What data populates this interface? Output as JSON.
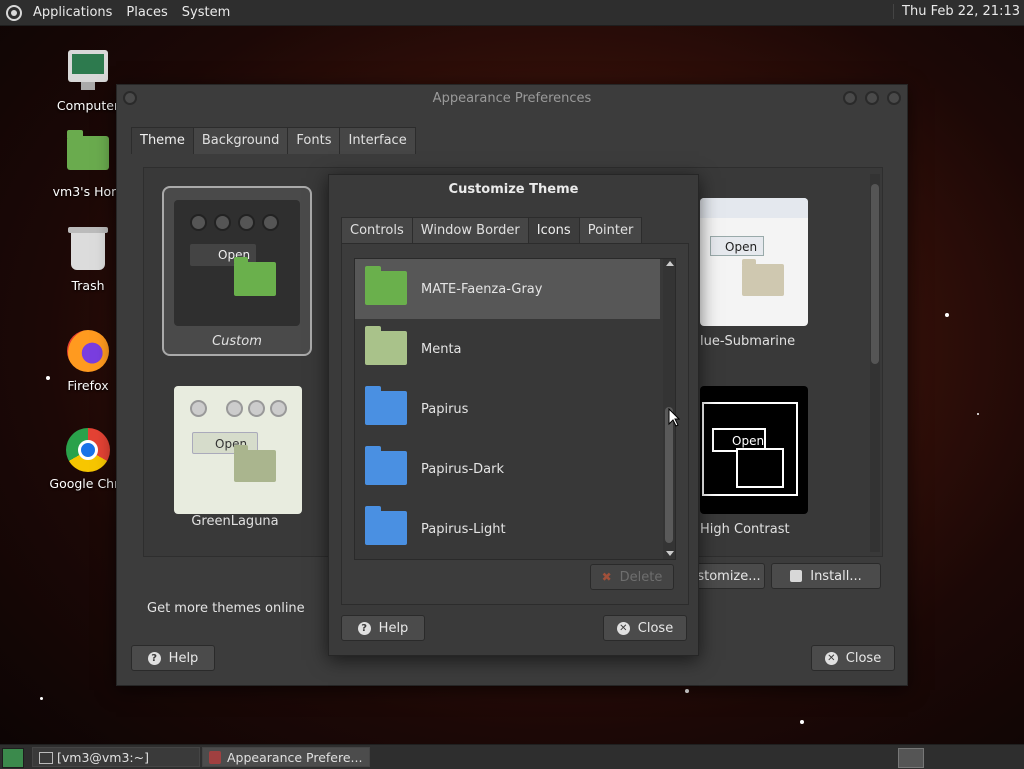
{
  "top_panel": {
    "menus": [
      "Applications",
      "Places",
      "System"
    ],
    "clock": "Thu Feb 22, 21:13"
  },
  "desktop_icons": [
    "Computer",
    "vm3's Hom",
    "Trash",
    "Firefox",
    "Google Chro"
  ],
  "appearance": {
    "title": "Appearance Preferences",
    "tabs": [
      "Theme",
      "Background",
      "Fonts",
      "Interface"
    ],
    "themes": [
      "Custom",
      "lue-Submarine",
      "GreenLaguna",
      "High Contrast"
    ],
    "thumb_open": "Open",
    "get_more": "Get more themes online",
    "customize_label": "stomize...",
    "install_label": "Install...",
    "help_label": "Help",
    "close_label": "Close"
  },
  "customize": {
    "title": "Customize Theme",
    "tabs": [
      "Controls",
      "Window Border",
      "Icons",
      "Pointer"
    ],
    "icons": [
      {
        "name": "MATE-Faenza-Gray",
        "color": "#6ab04c"
      },
      {
        "name": "Menta",
        "color": "#a9c28a"
      },
      {
        "name": "Papirus",
        "color": "#4a90e2"
      },
      {
        "name": "Papirus-Dark",
        "color": "#4a90e2"
      },
      {
        "name": "Papirus-Light",
        "color": "#4a90e2"
      }
    ],
    "delete_label": "Delete",
    "help_label": "Help",
    "close_label": "Close"
  },
  "taskbar": {
    "items": [
      "[vm3@vm3:~]",
      "Appearance Prefere..."
    ]
  }
}
